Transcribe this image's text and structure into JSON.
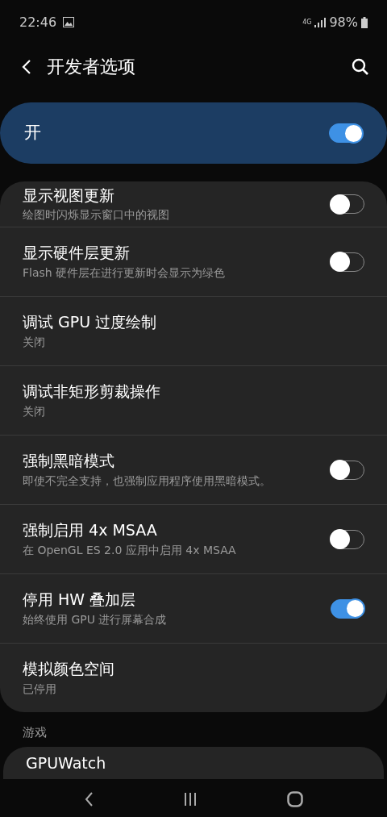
{
  "status_bar": {
    "time": "22:46",
    "network": "4G",
    "battery": "98%"
  },
  "header": {
    "title": "开发者选项"
  },
  "master_switch": {
    "label": "开",
    "on": true
  },
  "settings": [
    {
      "kind": "switch",
      "title": "显示视图更新",
      "subtitle": "绘图时闪烁显示窗口中的视图",
      "on": false
    },
    {
      "kind": "switch",
      "title": "显示硬件层更新",
      "subtitle": "Flash 硬件层在进行更新时会显示为绿色",
      "on": false
    },
    {
      "kind": "plain",
      "title": "调试 GPU 过度绘制",
      "subtitle": "关闭"
    },
    {
      "kind": "plain",
      "title": "调试非矩形剪裁操作",
      "subtitle": "关闭"
    },
    {
      "kind": "switch",
      "title": "强制黑暗模式",
      "subtitle": "即使不完全支持，也强制应用程序使用黑暗模式。",
      "on": false
    },
    {
      "kind": "switch",
      "title": "强制启用 4x MSAA",
      "subtitle": "在 OpenGL ES 2.0 应用中启用 4x MSAA",
      "on": false
    },
    {
      "kind": "switch",
      "title": "停用 HW 叠加层",
      "subtitle": "始终使用 GPU 进行屏幕合成",
      "on": true
    },
    {
      "kind": "plain",
      "title": "模拟颜色空间",
      "subtitle": "已停用"
    }
  ],
  "section": {
    "title": "游戏",
    "items": [
      {
        "title": "GPUWatch"
      }
    ]
  }
}
